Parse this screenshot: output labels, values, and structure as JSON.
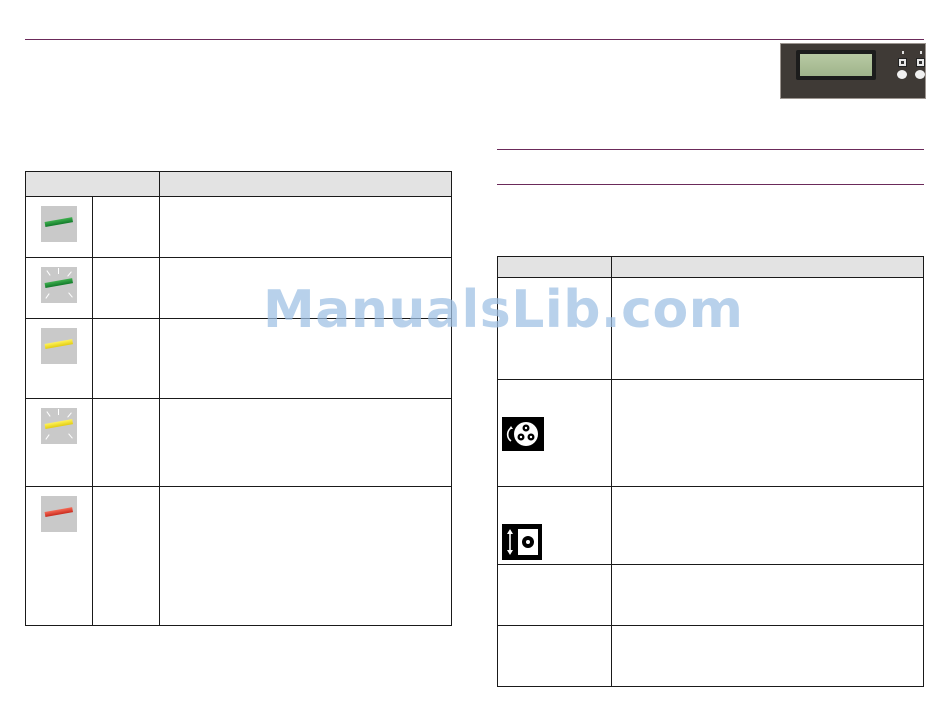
{
  "watermark": {
    "text": "ManualsLib.com"
  },
  "colors": {
    "rule": "#6b2a5a",
    "header_fill": "#e3e3e3",
    "led_green": "#2ea043",
    "led_yellow": "#f5e02a",
    "led_red": "#e0483a"
  },
  "led_table": {
    "rows": [
      {
        "swatch": "green",
        "blinking": false
      },
      {
        "swatch": "green",
        "blinking": true
      },
      {
        "swatch": "yellow",
        "blinking": false
      },
      {
        "swatch": "yellow",
        "blinking": true
      },
      {
        "swatch": "red",
        "blinking": false
      }
    ]
  },
  "icon_table": {
    "rows": [
      {
        "icon": null
      },
      {
        "icon": "reels-rotate-icon"
      },
      {
        "icon": "disc-up-down-icon"
      },
      {
        "icon": null
      },
      {
        "icon": null
      }
    ]
  }
}
